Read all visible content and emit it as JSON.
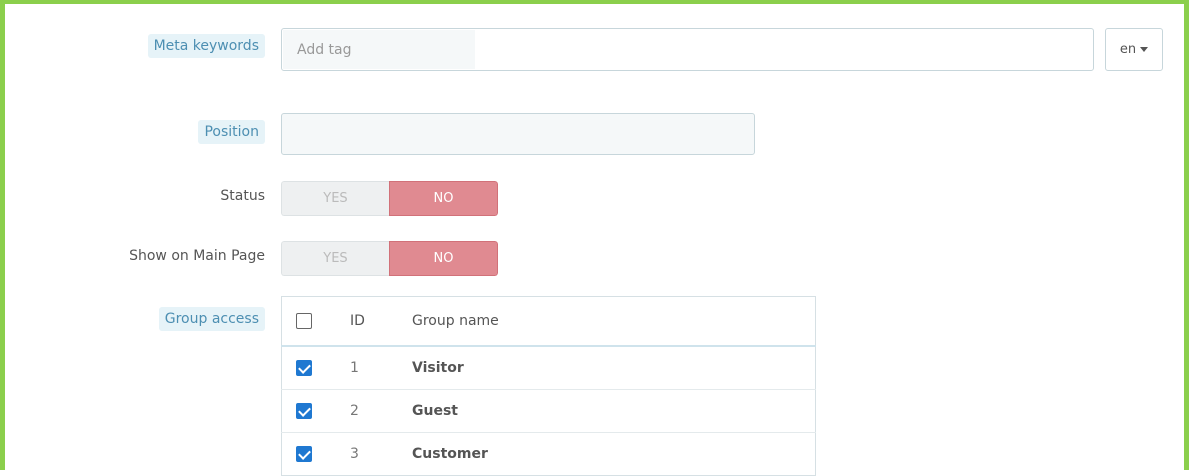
{
  "meta_keywords": {
    "label": "Meta keywords",
    "placeholder": "Add tag",
    "lang": "en"
  },
  "position": {
    "label": "Position",
    "value": ""
  },
  "status": {
    "label": "Status",
    "yes": "YES",
    "no": "NO",
    "selected": "NO"
  },
  "show_on_main": {
    "label": "Show on Main Page",
    "yes": "YES",
    "no": "NO",
    "selected": "NO"
  },
  "group_access": {
    "label": "Group access",
    "columns": [
      "ID",
      "Group name"
    ],
    "rows": [
      {
        "id": "1",
        "name": "Visitor",
        "checked": true
      },
      {
        "id": "2",
        "name": "Guest",
        "checked": true
      },
      {
        "id": "3",
        "name": "Customer",
        "checked": true
      }
    ]
  },
  "colors": {
    "frame": "#8bcf4c",
    "no_active": "#e08a91",
    "checkbox": "#1f78d1"
  }
}
